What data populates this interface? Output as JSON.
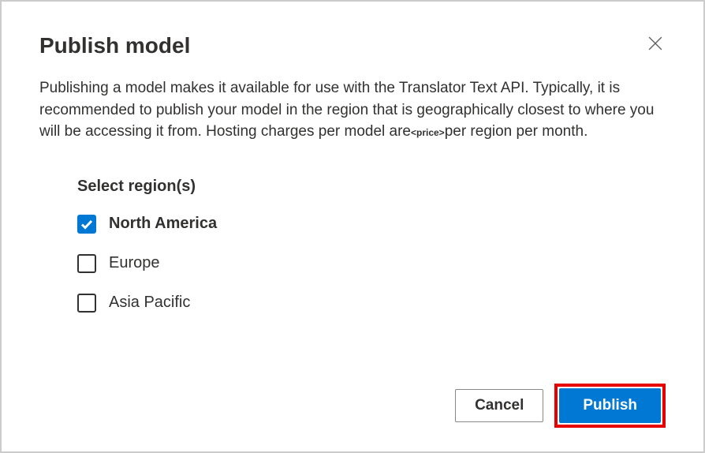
{
  "dialog": {
    "title": "Publish model",
    "description_part1": "Publishing a model makes it available for use with the Translator Text API. Typically, it is recommended to publish your model in the region that is geographically closest to where you will be accessing it from. Hosting charges per model are",
    "description_price": "<price>",
    "description_part2": "per region per month."
  },
  "regions": {
    "label": "Select region(s)",
    "items": [
      {
        "label": "North America",
        "checked": true
      },
      {
        "label": "Europe",
        "checked": false
      },
      {
        "label": "Asia Pacific",
        "checked": false
      }
    ]
  },
  "buttons": {
    "cancel": "Cancel",
    "publish": "Publish"
  }
}
